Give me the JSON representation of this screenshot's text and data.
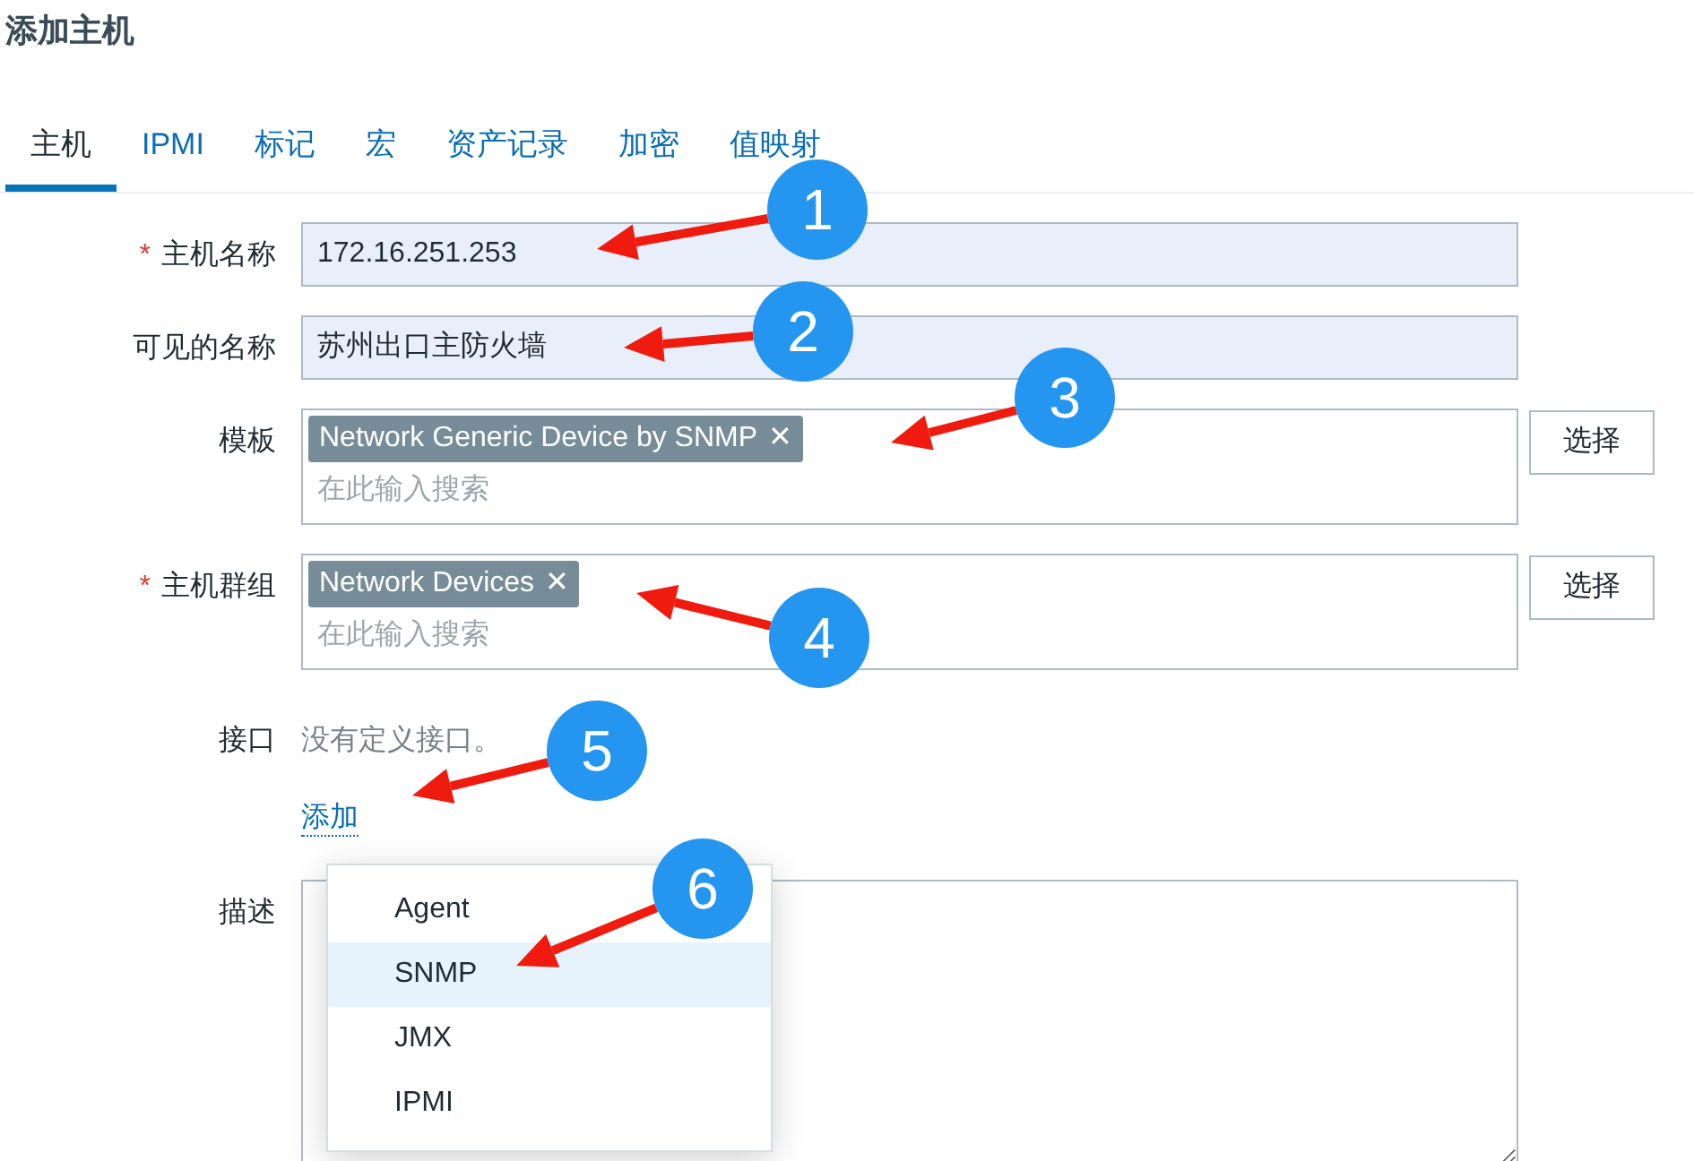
{
  "title": "添加主机",
  "tabs": [
    {
      "label": "主机",
      "selected": true
    },
    {
      "label": "IPMI",
      "selected": false
    },
    {
      "label": "标记",
      "selected": false
    },
    {
      "label": "宏",
      "selected": false
    },
    {
      "label": "资产记录",
      "selected": false
    },
    {
      "label": "加密",
      "selected": false
    },
    {
      "label": "值映射",
      "selected": false
    }
  ],
  "form": [
    {
      "kind": "text",
      "label": "主机名称",
      "required": true,
      "value": "172.16.251.253"
    },
    {
      "kind": "text",
      "label": "可见的名称",
      "required": false,
      "value": "苏州出口主防火墙"
    },
    {
      "kind": "multiselect",
      "label": "模板",
      "required": false,
      "tags": [
        "Network Generic Device by SNMP"
      ],
      "remove": "✕",
      "placeholder": "在此输入搜索",
      "button": "选择"
    },
    {
      "kind": "multiselect",
      "label": "主机群组",
      "required": true,
      "tags": [
        "Network Devices"
      ],
      "remove": "✕",
      "placeholder": "在此输入搜索",
      "button": "选择"
    },
    {
      "kind": "interfaces",
      "label": "接口",
      "note": "没有定义接口。",
      "link": "添加"
    },
    {
      "kind": "textarea",
      "label": "描述",
      "required": false
    }
  ],
  "required_mark": "*",
  "menu": [
    {
      "label": "Agent",
      "selected": false
    },
    {
      "label": "SNMP",
      "selected": true
    },
    {
      "label": "JMX",
      "selected": false
    },
    {
      "label": "IPMI",
      "selected": false
    }
  ],
  "callouts": [
    "1",
    "2",
    "3",
    "4",
    "5",
    "6"
  ]
}
